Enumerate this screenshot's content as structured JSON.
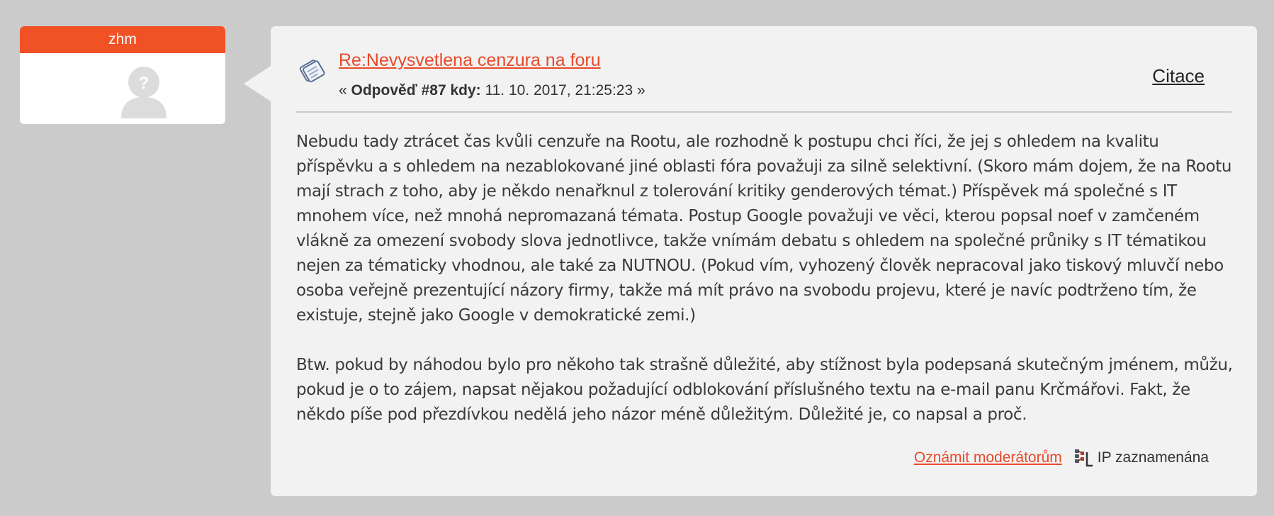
{
  "user": {
    "name": "zhm"
  },
  "post": {
    "title": "Re:Nevysvetlena cenzura na foru",
    "meta": {
      "open": "« ",
      "reply_label": "Odpověď #87 kdy:",
      "datetime": " 11. 10. 2017, 21:25:23 ",
      "close": "»"
    },
    "quote_label": "Citace",
    "body": [
      "Nebudu tady ztrácet čas kvůli cenzuře na Rootu, ale rozhodně k postupu chci říci, že jej s ohledem na kvalitu příspěvku a s ohledem na nezablokované jiné oblasti fóra považuji za silně selektivní. (Skoro mám dojem, že na Rootu mají strach z toho, aby je někdo nenařknul z tolerování kritiky genderových témat.) Příspěvek má společné s IT mnohem více, než mnohá nepromazaná témata. Postup Google považuji ve věci, kterou popsal noef v zamčeném vlákně za omezení svobody slova jednotlivce, takže vnímám debatu s ohledem na společné průniky s IT tématikou nejen za tématicky vhodnou, ale také za NUTNOU. (Pokud vím, vyhozený člověk nepracoval jako tiskový mluvčí nebo osoba veřejně prezentující názory firmy, takže má mít právo na svobodu projevu, které je navíc podtrženo tím, že existuje, stejně jako Google v demokratické zemi.)",
      "Btw. pokud by náhodou bylo pro někoho tak strašně důležité, aby stížnost byla podepsaná skutečným jménem, můžu, pokud je o to zájem, napsat nějakou požadující odblokování příslušného textu na e-mail panu Krčmářovi. Fakt, že někdo píše pod přezdívkou nedělá jeho názor méně důležitým. Důležité je, co napsal a proč."
    ],
    "footer": {
      "report_label": "Oznámit moderátorům",
      "ip_label": "IP zaznamenána"
    }
  },
  "colors": {
    "background": "#cbcbcb",
    "accent": "#f05125",
    "link": "#e8492a",
    "panel": "#f2f2f2"
  },
  "icons": [
    "avatar-placeholder-icon",
    "post-icon",
    "ip-logged-icon"
  ]
}
